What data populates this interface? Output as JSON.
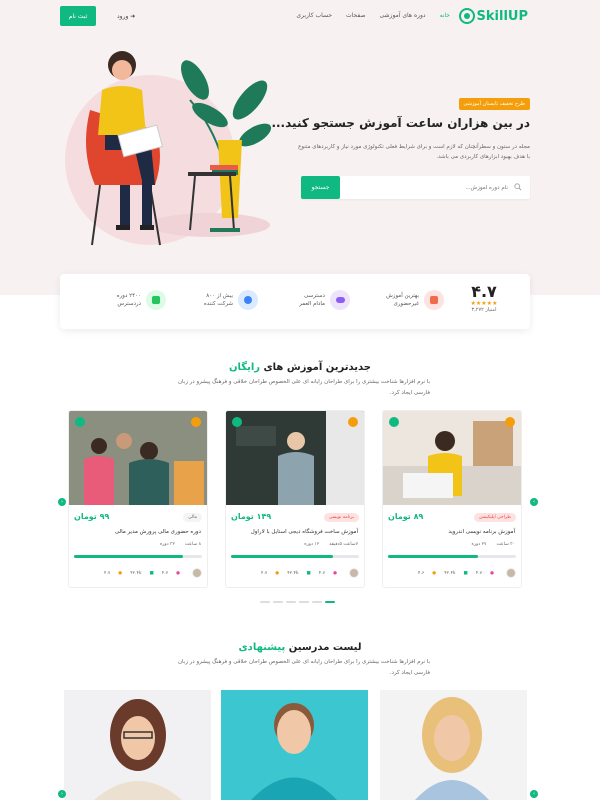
{
  "header": {
    "logo": "SkillUP",
    "nav": [
      {
        "label": "خانه"
      },
      {
        "label": "دوره های آموزشی"
      },
      {
        "label": "صفحات"
      },
      {
        "label": "حساب کاربری"
      }
    ],
    "login": "ورود",
    "signup": "ثبت نام"
  },
  "hero": {
    "badge": "طرح تخفیف تابستان آموزشی",
    "title": "در بین هزاران ساعت آموزش جستجو کنید...",
    "description": "مجله در ستون و سطرآنچنان که لازم است و برای شرایط فعلی تکنولوژی مورد نیاز و کاربردهای متنوع با هدف بهبود ابزارهای کاربردی می باشد.",
    "search_placeholder": "نام دوره آموزش...",
    "search_button": "جستجو"
  },
  "stats": {
    "rating": "۴.۷",
    "rating_label": "امتیاز ۳,۲۷۲",
    "items": [
      {
        "line1": "بهترین آموزش",
        "line2": "غیرحضوری",
        "color": "#fde2e2",
        "icon": "book-stack-icon"
      },
      {
        "line1": "دسترسی",
        "line2": "مادام العمر",
        "color": "#ede3fb",
        "icon": "cloud-icon"
      },
      {
        "line1": "بیش از ۸۰۰",
        "line2": "شرکت کننده",
        "color": "#dbeafe",
        "icon": "users-icon"
      },
      {
        "line1": "۲۴۰۰ دوره",
        "line2": "دردسترس",
        "color": "#dcfce7",
        "icon": "stack-icon"
      }
    ]
  },
  "courses_section": {
    "title_main": "جدیدترین آموزش های",
    "title_highlight": "رایگان",
    "description": "با نرم افزارها شناخت بیشتری را برای طراحان رایانه ای علی الخصوص طراحان خلاقی و فرهنگ پیشرو در زبان فارسی ایجاد کرد."
  },
  "courses": [
    {
      "category": "طراحی اپلیکیشن",
      "cat_bg": "#fde2e2",
      "cat_color": "#ef4444",
      "price": "۸۹ تومان",
      "title": "آموزش برنامه نویسی اندروید",
      "lessons": "۲۷ دوره",
      "duration": "۳۰ ساعت",
      "progress": 0.7,
      "students": "۴.۷",
      "views": "۴۲.۴k",
      "rate": "۴.۶"
    },
    {
      "category": "برنامه نویسی",
      "cat_bg": "#fde2e2",
      "cat_color": "#ef4444",
      "price": "۱۴۹ تومان",
      "title": "آموزش ساخت فروشگاه دیجی استایل با لاراول",
      "lessons": "۱۲ دوره",
      "duration": "۷ساعت ۵دقیقه",
      "progress": 0.8,
      "students": "۴.۷",
      "views": "۴۲.۴k",
      "rate": "۴.۷"
    },
    {
      "category": "مالی",
      "cat_bg": "#f3f4f6",
      "cat_color": "#666666",
      "price": "۹۹ تومان",
      "title": "دوره حضوری مالی پرورش مدیر مالی",
      "lessons": "۳۲ دوره",
      "duration": "۸ ساعت",
      "progress": 0.85,
      "students": "۴.۷",
      "views": "۴۲.۴k",
      "rate": "۴.۷"
    }
  ],
  "instructors_section": {
    "title_main": "لیست مدرسین",
    "title_highlight": "پیشنهادی",
    "description": "با نرم افزارها شناخت بیشتری را برای طراحان رایانه ای علی الخصوص طراحان خلاقی و فرهنگ پیشرو در زبان فارسی ایجاد کرد."
  },
  "instructors": [
    {
      "bg": "#f1f1f3"
    },
    {
      "bg": "#3cc6d0"
    },
    {
      "bg": "#f3f3f3"
    }
  ]
}
